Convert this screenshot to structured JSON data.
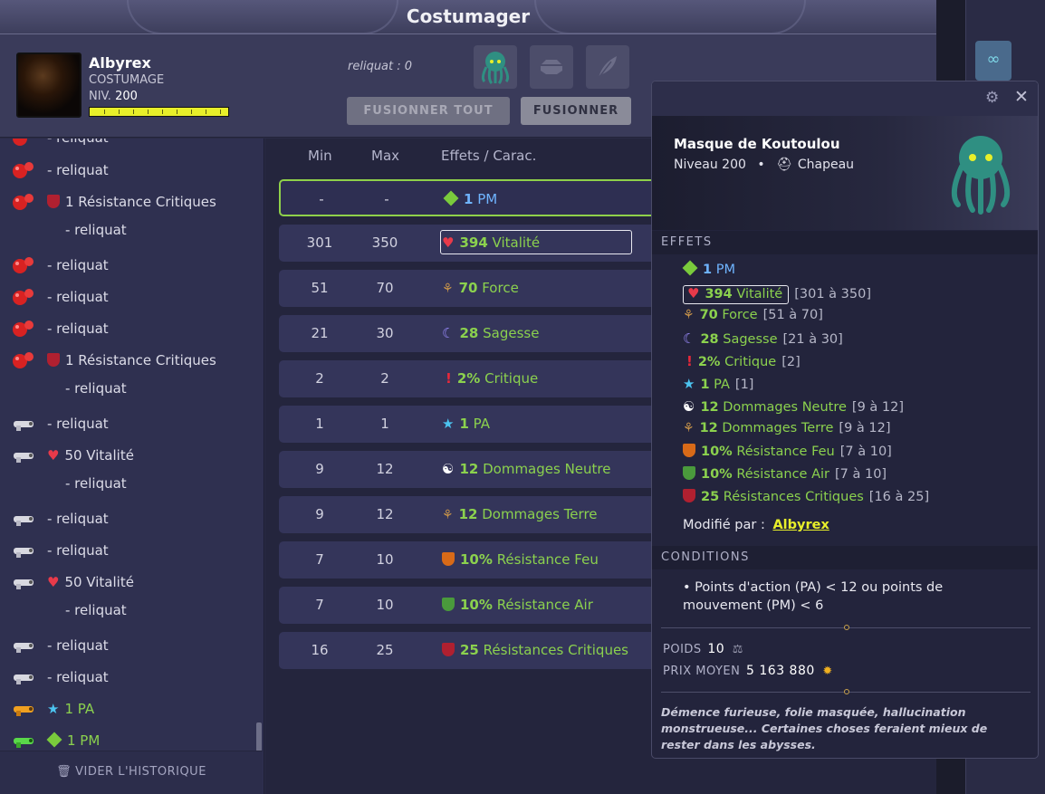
{
  "window": {
    "title": "Costumager"
  },
  "player": {
    "name": "Albyrex",
    "job": "COSTUMAGE",
    "level_label": "NIV.",
    "level": "200",
    "xp_fraction": 1.0
  },
  "header": {
    "reliquat": "reliquat : 0",
    "fuse_all_label": "FUSIONNER TOUT",
    "fuse_label": "FUSIONNER"
  },
  "history": {
    "items": [
      {
        "icon": "red-mace-icon",
        "text": "- reliquat"
      },
      {
        "icon": "red-mace-icon",
        "text": "- reliquat"
      },
      {
        "icon": "red-mace-icon",
        "text": "1 Résistance Critiques",
        "sub": "- reliquat"
      },
      {
        "icon": "red-mace-icon",
        "text": "- reliquat"
      },
      {
        "icon": "red-mace-icon",
        "text": "- reliquat"
      },
      {
        "icon": "red-mace-icon",
        "text": "- reliquat"
      },
      {
        "icon": "red-mace-icon",
        "text": "1 Résistance Critiques",
        "sub": "- reliquat"
      },
      {
        "icon": "white-gun-icon",
        "text": "- reliquat"
      },
      {
        "icon": "white-gun-icon",
        "text": "50 Vitalité",
        "sub": "- reliquat"
      },
      {
        "icon": "white-gun-icon",
        "text": "- reliquat"
      },
      {
        "icon": "white-gun-icon",
        "text": "- reliquat"
      },
      {
        "icon": "white-gun-icon",
        "text": "50 Vitalité",
        "sub": "- reliquat"
      },
      {
        "icon": "white-gun-icon",
        "text": "- reliquat"
      },
      {
        "icon": "white-gun-icon",
        "text": "- reliquat"
      },
      {
        "icon": "orange-gun-icon",
        "text": "1 PA"
      },
      {
        "icon": "green-gun-icon",
        "text": "1 PM"
      }
    ],
    "clear_label": "VIDER L'HISTORIQUE"
  },
  "table": {
    "headers": [
      "Min",
      "Max",
      "Effets / Carac."
    ],
    "rows": [
      {
        "min": "-",
        "max": "-",
        "value": "1",
        "name": "PM",
        "icon": "pm-icon",
        "selected": true
      },
      {
        "min": "301",
        "max": "350",
        "value": "394",
        "name": "Vitalité",
        "icon": "heart-icon",
        "boxed": true
      },
      {
        "min": "51",
        "max": "70",
        "value": "70",
        "name": "Force",
        "icon": "force-icon"
      },
      {
        "min": "21",
        "max": "30",
        "value": "28",
        "name": "Sagesse",
        "icon": "moon-icon"
      },
      {
        "min": "2",
        "max": "2",
        "value": "2%",
        "name": "Critique",
        "icon": "exclamation-icon"
      },
      {
        "min": "1",
        "max": "1",
        "value": "1",
        "name": "PA",
        "icon": "star-icon"
      },
      {
        "min": "9",
        "max": "12",
        "value": "12",
        "name": "Dommages Neutre",
        "icon": "yinyang-icon"
      },
      {
        "min": "9",
        "max": "12",
        "value": "12",
        "name": "Dommages Terre",
        "icon": "force-icon"
      },
      {
        "min": "7",
        "max": "10",
        "value": "10%",
        "name": "Résistance Feu",
        "icon": "fire-shield-icon"
      },
      {
        "min": "7",
        "max": "10",
        "value": "10%",
        "name": "Résistance Air",
        "icon": "air-shield-icon"
      },
      {
        "min": "16",
        "max": "25",
        "value": "25",
        "name": "Résistances Critiques",
        "icon": "crit-shield-icon"
      }
    ]
  },
  "item": {
    "name": "Masque de Koutoulou",
    "level": "Niveau 200",
    "bullet": "•",
    "type": "Chapeau",
    "effects_title": "EFFETS",
    "effects": [
      {
        "value": "1",
        "name": "PM",
        "range": "",
        "icon": "pm-icon"
      },
      {
        "value": "394",
        "name": "Vitalité",
        "range": "[301 à 350]",
        "icon": "heart-icon"
      },
      {
        "value": "70",
        "name": "Force",
        "range": "[51 à 70]",
        "icon": "force-icon"
      },
      {
        "value": "28",
        "name": "Sagesse",
        "range": "[21 à 30]",
        "icon": "moon-icon"
      },
      {
        "value": "2%",
        "name": "Critique",
        "range": "[2]",
        "icon": "exclamation-icon"
      },
      {
        "value": "1",
        "name": "PA",
        "range": "[1]",
        "icon": "star-icon"
      },
      {
        "value": "12",
        "name": "Dommages Neutre",
        "range": "[9 à 12]",
        "icon": "yinyang-icon"
      },
      {
        "value": "12",
        "name": "Dommages Terre",
        "range": "[9 à 12]",
        "icon": "force-icon"
      },
      {
        "value": "10%",
        "name": "Résistance Feu",
        "range": "[7 à 10]",
        "icon": "fire-shield-icon"
      },
      {
        "value": "10%",
        "name": "Résistance Air",
        "range": "[7 à 10]",
        "icon": "air-shield-icon"
      },
      {
        "value": "25",
        "name": "Résistances Critiques",
        "range": "[16 à 25]",
        "icon": "crit-shield-icon"
      }
    ],
    "modified_by_label": "Modifié par :",
    "modified_by": "Albyrex",
    "conditions_title": "CONDITIONS",
    "condition": "• Points d'action (PA) < 12 ou points de mouvement (PM) < 6",
    "weight_label": "POIDS",
    "weight": "10",
    "price_label": "PRIX MOYEN",
    "price": "5 163 880",
    "description": "Démence furieuse, folie masquée, hallucination monstrueuse... Certaines choses feraient mieux de rester dans les abysses."
  },
  "colors": {
    "accent_green": "#8bd14e",
    "pm_blue": "#6fb4ff",
    "link_yellow": "#e8ef2a"
  }
}
